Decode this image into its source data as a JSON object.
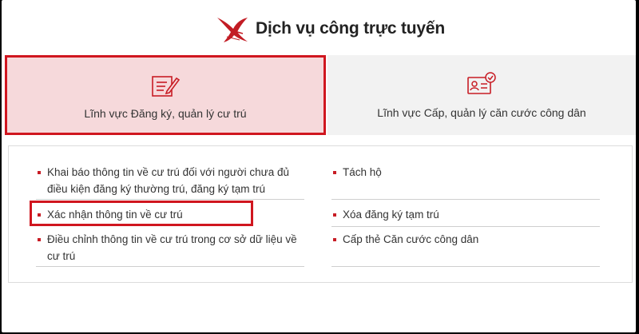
{
  "header": {
    "title": "Dịch vụ công trực tuyến",
    "logo_icon": "stork-logo-icon"
  },
  "tabs": [
    {
      "label": "Lĩnh vực Đăng ký, quản lý cư trú",
      "icon": "document-pen-icon",
      "selected": true
    },
    {
      "label": "Lĩnh vực Cấp, quản lý căn cước công dân",
      "icon": "id-card-check-icon",
      "selected": false
    }
  ],
  "services_left": [
    {
      "line1": "Khai báo thông tin về cư trú đối với người chưa đủ",
      "line2": "điều kiện đăng ký thường trú, đăng ký tạm trú"
    },
    {
      "line1": "Xác nhận thông tin về cư trú",
      "line2": ""
    },
    {
      "line1": "Điều chỉnh thông tin về cư trú trong cơ sở dữ liệu về",
      "line2": "cư trú"
    }
  ],
  "services_right": [
    {
      "line1": "Tách hộ"
    },
    {
      "line1": "Xóa đăng ký tạm trú"
    },
    {
      "line1": "Cấp thẻ Căn cước công dân"
    }
  ],
  "colors": {
    "accent": "#d0161f",
    "selected_tab_bg": "#f6d9db",
    "tab_bg": "#f2f2f2"
  }
}
